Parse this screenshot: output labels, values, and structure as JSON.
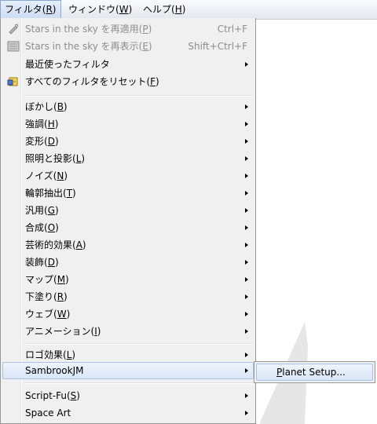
{
  "menubar": {
    "items": [
      {
        "label": "フィルタ(",
        "key": "R",
        "tail": ")"
      },
      {
        "label": "ウィンドウ(",
        "key": "W",
        "tail": ")"
      },
      {
        "label": "ヘルプ(",
        "key": "H",
        "tail": ")"
      }
    ]
  },
  "menu": {
    "reapply": {
      "label": "Stars in the sky を再適用(",
      "key": "P",
      "tail": ")",
      "shortcut": "Ctrl+F",
      "icon": "reapply-icon"
    },
    "reshow": {
      "label": "Stars in the sky を再表示(",
      "key": "E",
      "tail": ")",
      "shortcut": "Shift+Ctrl+F",
      "icon": "reshow-icon"
    },
    "recent": {
      "label": "最近使ったフィルタ"
    },
    "reset": {
      "label": "すべてのフィルタをリセット(",
      "key": "F",
      "tail": ")",
      "icon": "reset-icon"
    },
    "blur": {
      "label": "ぼかし(",
      "key": "B",
      "tail": ")"
    },
    "enhance": {
      "label": "強調(",
      "key": "H",
      "tail": ")"
    },
    "distort": {
      "label": "変形(",
      "key": "D",
      "tail": ")"
    },
    "light": {
      "label": "照明と投影(",
      "key": "L",
      "tail": ")"
    },
    "noise": {
      "label": "ノイズ(",
      "key": "N",
      "tail": ")"
    },
    "edge": {
      "label": "輪郭抽出(",
      "key": "T",
      "tail": ")"
    },
    "generic": {
      "label": "汎用(",
      "key": "G",
      "tail": ")"
    },
    "combine": {
      "label": "合成(",
      "key": "O",
      "tail": ")"
    },
    "artistic": {
      "label": "芸術的効果(",
      "key": "A",
      "tail": ")"
    },
    "decor": {
      "label": "装飾(",
      "key": "D",
      "tail": ")"
    },
    "map": {
      "label": "マップ(",
      "key": "M",
      "tail": ")"
    },
    "render": {
      "label": "下塗り(",
      "key": "R",
      "tail": ")"
    },
    "web": {
      "label": "ウェブ(",
      "key": "W",
      "tail": ")"
    },
    "animation": {
      "label": "アニメーション(",
      "key": "I",
      "tail": ")"
    },
    "logo": {
      "label": "ロゴ効果(",
      "key": "L",
      "tail": ")"
    },
    "sambrook": {
      "label": "SambrookJM"
    },
    "scriptfu": {
      "label": "Script-Fu(",
      "key": "S",
      "tail": ")"
    },
    "spaceart": {
      "label": "Space Art"
    }
  },
  "submenu": {
    "planet": {
      "key": "P",
      "label": "lanet Setup..."
    }
  },
  "colors": {
    "menu_bg": "#f0f0f0",
    "highlight_border": "#a9c2e4",
    "disabled_text": "#8d8d8d"
  }
}
